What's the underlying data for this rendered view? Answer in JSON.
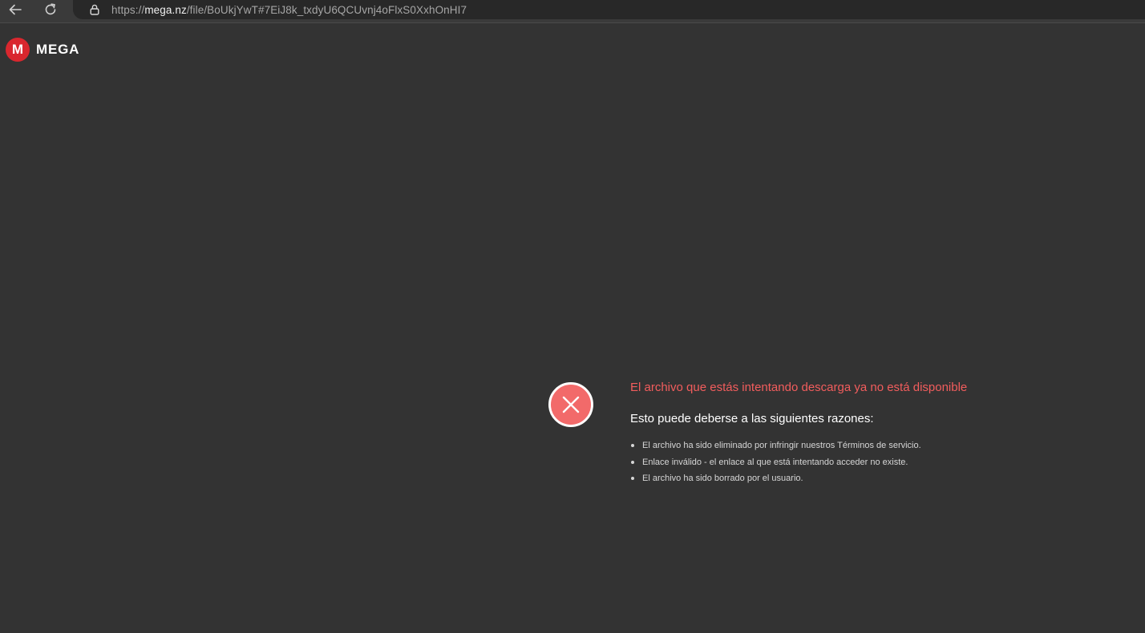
{
  "browser": {
    "url_prefix": "https://",
    "url_host": "mega.nz",
    "url_path": "/file/BoUkjYwT#7EiJ8k_txdyU6QCUvnj4oFlxS0XxhOnHI7"
  },
  "logo": {
    "mark": "M",
    "name": "MEGA",
    "brand_color": "#d9272e"
  },
  "error": {
    "title": "El archivo que estás intentando descarga ya no está disponible",
    "reasons_title": "Esto puede deberse a las siguientes razones:",
    "reasons": [
      "El archivo ha sido eliminado por infringir nuestros Términos de servicio.",
      "Enlace inválido - el enlace al que está intentando acceder no existe.",
      "El archivo ha sido borrado por el usuario."
    ],
    "accent_color": "#f25d5d",
    "icon": "error-x-circle-icon"
  }
}
